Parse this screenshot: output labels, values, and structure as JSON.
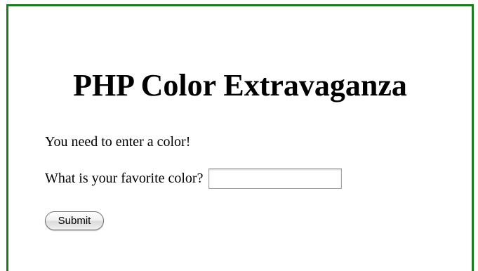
{
  "page": {
    "title": "PHP Color Extravaganza",
    "error_message": "You need to enter a color!",
    "border_color": "#1e7a1e"
  },
  "form": {
    "color_label": "What is your favorite color?",
    "color_value": "",
    "submit_label": "Submit"
  }
}
